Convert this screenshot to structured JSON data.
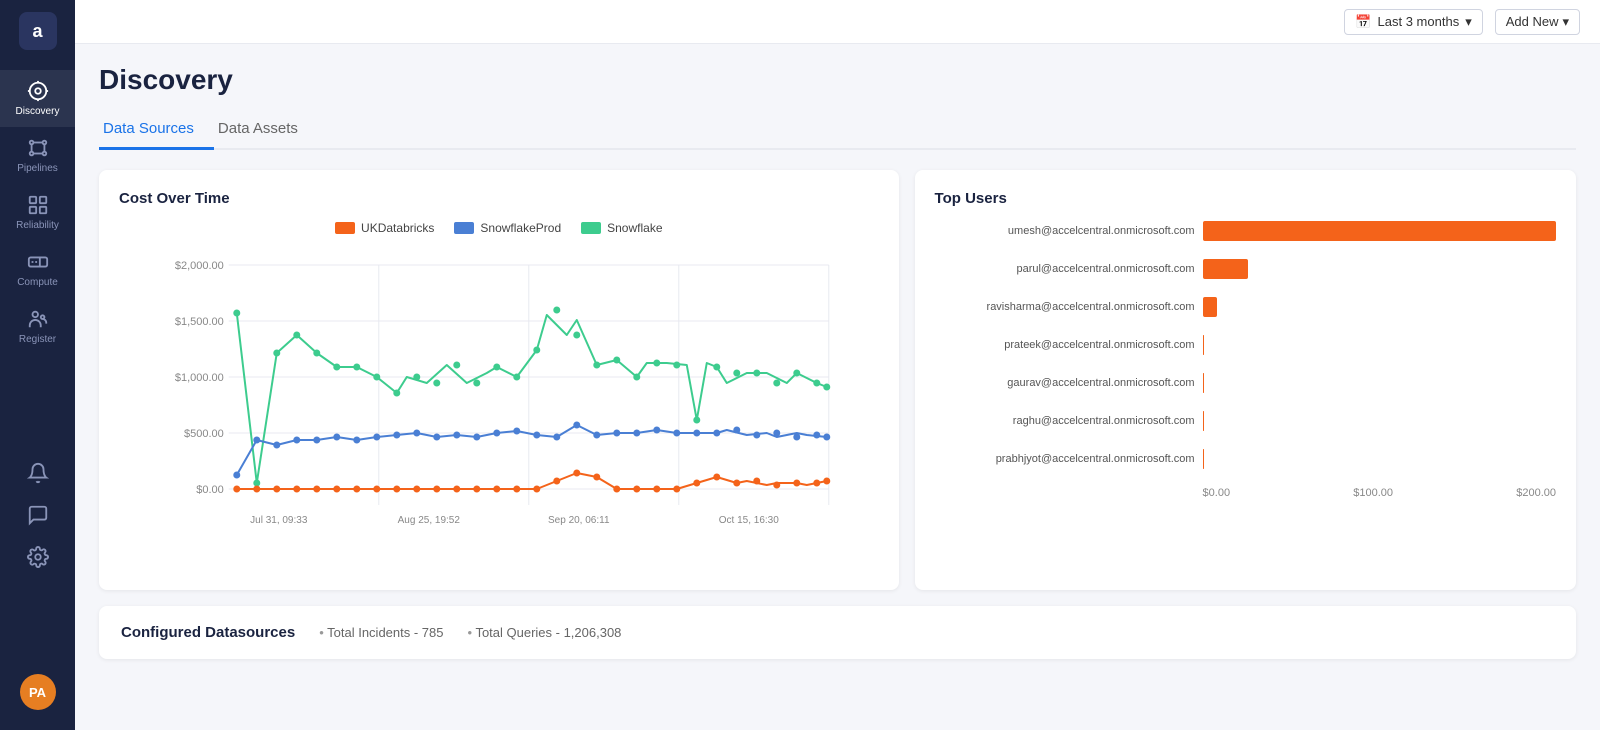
{
  "sidebar": {
    "logo": "a",
    "items": [
      {
        "id": "discovery",
        "label": "Discovery",
        "active": true
      },
      {
        "id": "pipelines",
        "label": "Pipelines",
        "active": false
      },
      {
        "id": "reliability",
        "label": "Reliability",
        "active": false
      },
      {
        "id": "compute",
        "label": "Compute",
        "active": false
      },
      {
        "id": "register",
        "label": "Register",
        "active": false
      },
      {
        "id": "alerts",
        "label": "",
        "active": false
      },
      {
        "id": "messages",
        "label": "",
        "active": false
      },
      {
        "id": "settings",
        "label": "",
        "active": false
      }
    ],
    "avatar": "PA"
  },
  "topbar": {
    "date_filter": "Last 3 months",
    "add_new": "Add New"
  },
  "page": {
    "title": "Discovery",
    "tabs": [
      {
        "id": "data-sources",
        "label": "Data Sources",
        "active": true
      },
      {
        "id": "data-assets",
        "label": "Data Assets",
        "active": false
      }
    ]
  },
  "cost_chart": {
    "title": "Cost Over Time",
    "legend": [
      {
        "id": "uk-databricks",
        "label": "UKDatabricks",
        "color": "#f4631a"
      },
      {
        "id": "snowflake-prod",
        "label": "SnowflakeProd",
        "color": "#4a7fd4"
      },
      {
        "id": "snowflake",
        "label": "Snowflake",
        "color": "#3dcc8e"
      }
    ],
    "y_labels": [
      "$2,000.00",
      "$1,500.00",
      "$1,000.00",
      "$500.00",
      "$0.00"
    ],
    "x_labels": [
      "Jul 31, 09:33",
      "Aug 25, 19:52",
      "Sep 20, 06:11",
      "Oct 15, 16:30"
    ]
  },
  "top_users": {
    "title": "Top Users",
    "users": [
      {
        "email": "umesh@accelcentral.onmicrosoft.com",
        "value": 200,
        "pct": 100
      },
      {
        "email": "parul@accelcentral.onmicrosoft.com",
        "value": 25,
        "pct": 12
      },
      {
        "email": "ravisharma@accelcentral.onmicrosoft.com",
        "value": 8,
        "pct": 4
      },
      {
        "email": "prateek@accelcentral.onmicrosoft.com",
        "value": 0,
        "pct": 0
      },
      {
        "email": "gaurav@accelcentral.onmicrosoft.com",
        "value": 0,
        "pct": 0
      },
      {
        "email": "raghu@accelcentral.onmicrosoft.com",
        "value": 0,
        "pct": 0
      },
      {
        "email": "prabhjyot@accelcentral.onmicrosoft.com",
        "value": 0,
        "pct": 0
      }
    ],
    "x_labels": [
      "$0.00",
      "$100.00",
      "$200.00"
    ]
  },
  "configured": {
    "title": "Configured Datasources",
    "total_incidents_label": "Total Incidents - 785",
    "total_queries_label": "Total Queries - 1,206,308"
  }
}
